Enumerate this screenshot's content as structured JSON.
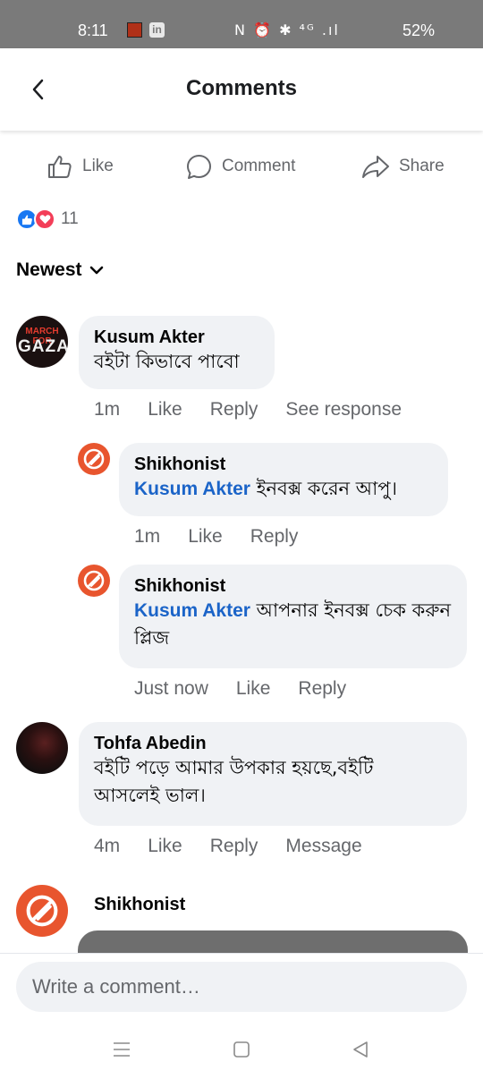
{
  "status_bar": {
    "time": "8:11",
    "app_icon_2": "in",
    "icons_text": "N ⏰ ✱ ⁴ᴳ .ıl",
    "battery": "52%"
  },
  "header": {
    "title": "Comments"
  },
  "actions": {
    "like": "Like",
    "comment": "Comment",
    "share": "Share"
  },
  "reactions": {
    "count": "11"
  },
  "sort": {
    "label": "Newest"
  },
  "comments": [
    {
      "author": "Kusum Akter",
      "avatar_text_top": "MARCH FOR",
      "avatar_text_main": "GAZA",
      "text": "বইটা কিভাবে পাবো",
      "time": "1m",
      "like": "Like",
      "reply": "Reply",
      "extra": "See response",
      "replies": [
        {
          "author": "Shikhonist",
          "mention": "Kusum Akter",
          "text": " ইনবক্স করেন আপু।",
          "time": "1m",
          "like": "Like",
          "reply": "Reply"
        },
        {
          "author": "Shikhonist",
          "mention": "Kusum Akter",
          "text": " আপনার ইনবক্স চেক করুন প্লিজ",
          "time": "Just now",
          "like": "Like",
          "reply": "Reply"
        }
      ]
    },
    {
      "author": "Tohfa Abedin",
      "text": "বইটি পড়ে আমার উপকার হয়ছে,বইটি আসলেই ভাল।",
      "time": "4m",
      "like": "Like",
      "reply": "Reply",
      "extra": "Message"
    },
    {
      "author": "Shikhonist"
    }
  ],
  "composer": {
    "placeholder": "Write a comment…"
  },
  "colors": {
    "accent": "#1877f2",
    "mention": "#1b64c8",
    "brand_orange": "#e8552e",
    "love": "#f33e58"
  }
}
